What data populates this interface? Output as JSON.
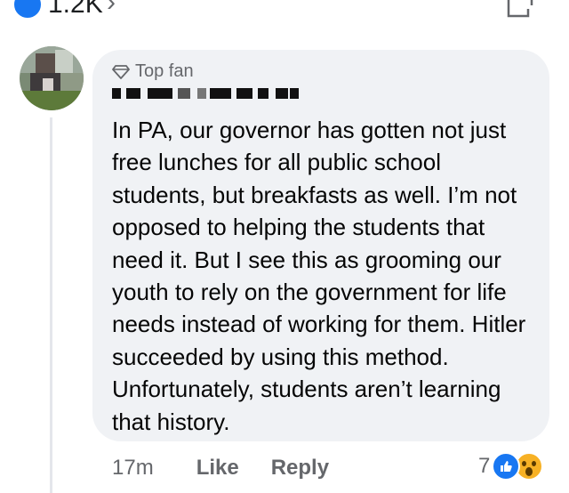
{
  "header": {
    "reaction_count": "1.2K",
    "chevron": "›",
    "icons": {
      "like": "like-reaction-icon",
      "share": "share-icon"
    }
  },
  "comment": {
    "badge_label": "Top fan",
    "badge_icon": "diamond-icon",
    "author_name_redacted": true,
    "text": "In PA, our governor has gotten not just free lunches for all public school students, but breakfasts as well. I’m not opposed to helping the students that need it. But I see this as grooming our youth to rely on the government for life needs instead of working for them. Hitler succeeded by using this method. Unfortunately, students aren’t learning that history.",
    "timestamp": "17m",
    "like_label": "Like",
    "reply_label": "Reply",
    "reaction_count": "7",
    "reactions": [
      "like",
      "wow"
    ]
  },
  "colors": {
    "bubble": "#f0f2f5",
    "secondary_text": "#65676b",
    "like_blue": "#1877f2",
    "wow_yellow": "#f7b125"
  }
}
